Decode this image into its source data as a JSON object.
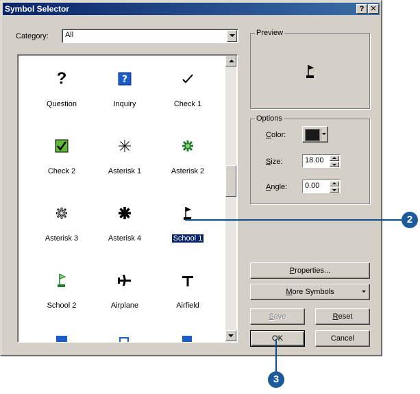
{
  "window": {
    "title": "Symbol Selector",
    "help_button": "?",
    "close_button": "✕"
  },
  "category": {
    "label": "Category:",
    "value": "All"
  },
  "symbols": [
    {
      "name": "Question",
      "icon": "question-mark"
    },
    {
      "name": "Inquiry",
      "icon": "boxed-question"
    },
    {
      "name": "Check 1",
      "icon": "check-mark"
    },
    {
      "name": "Check 2",
      "icon": "boxed-check"
    },
    {
      "name": "Asterisk 1",
      "icon": "thin-asterisk"
    },
    {
      "name": "Asterisk 2",
      "icon": "green-asterisk"
    },
    {
      "name": "Asterisk 3",
      "icon": "hollow-asterisk"
    },
    {
      "name": "Asterisk 4",
      "icon": "bold-asterisk"
    },
    {
      "name": "School 1",
      "icon": "school-flag",
      "selected": true
    },
    {
      "name": "School 2",
      "icon": "green-school-flag"
    },
    {
      "name": "Airplane",
      "icon": "airplane"
    },
    {
      "name": "Airfield",
      "icon": "airfield"
    }
  ],
  "preview": {
    "title": "Preview",
    "symbol_icon": "school-flag"
  },
  "options": {
    "title": "Options",
    "color_label": "Color:",
    "color_value": "#1a1a1a",
    "size_label": "Size:",
    "size_value": "18.00",
    "angle_label": "Angle:",
    "angle_value": "0.00"
  },
  "buttons": {
    "properties": "Properties...",
    "more_symbols": "More Symbols",
    "save": "Save",
    "reset": "Reset",
    "ok": "OK",
    "cancel": "Cancel"
  },
  "callouts": {
    "step2": "2",
    "step3": "3"
  },
  "colors": {
    "title_bar": "#0a246a",
    "selection": "#0a246a",
    "callout": "#1c5a9c",
    "face": "#d4d0c8"
  }
}
